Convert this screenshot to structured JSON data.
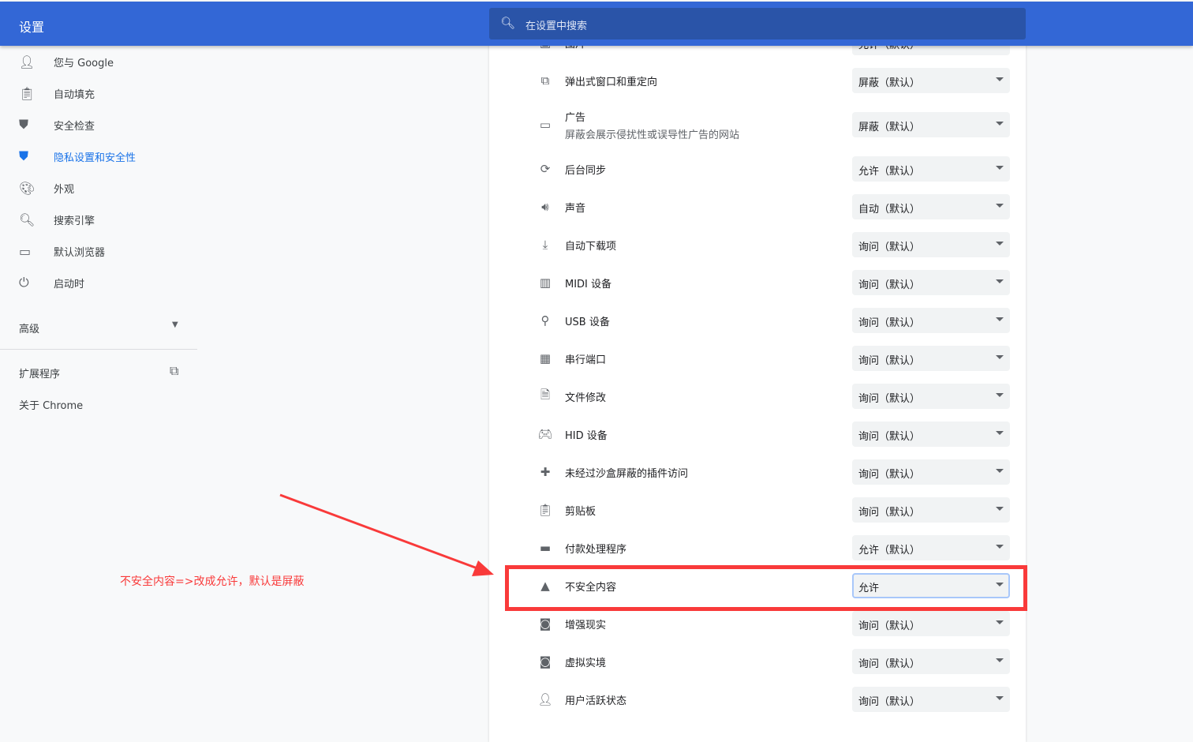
{
  "header": {
    "title": "设置",
    "search_placeholder": "在设置中搜索",
    "search_icon": "search-icon"
  },
  "sidebar": {
    "items": [
      {
        "label": "您与 Google",
        "icon": "person-icon"
      },
      {
        "label": "自动填充",
        "icon": "clipboard-icon"
      },
      {
        "label": "安全检查",
        "icon": "shield-check-icon"
      },
      {
        "label": "隐私设置和安全性",
        "icon": "shield-icon",
        "active": true
      },
      {
        "label": "外观",
        "icon": "palette-icon"
      },
      {
        "label": "搜索引擎",
        "icon": "search-icon"
      },
      {
        "label": "默认浏览器",
        "icon": "browser-icon"
      },
      {
        "label": "启动时",
        "icon": "power-icon"
      }
    ],
    "advanced": "高级",
    "extensions": "扩展程序",
    "about": "关于 Chrome"
  },
  "settings": [
    {
      "label": "图片",
      "value": "允许（默认）",
      "icon": "image-icon"
    },
    {
      "label": "弹出式窗口和重定向",
      "value": "屏蔽（默认）",
      "icon": "open-external-icon"
    },
    {
      "label": "广告",
      "sub": "屏蔽会展示侵扰性或误导性广告的网站",
      "value": "屏蔽（默认）",
      "icon": "ads-window-icon"
    },
    {
      "label": "后台同步",
      "value": "允许（默认）",
      "icon": "sync-icon"
    },
    {
      "label": "声音",
      "value": "自动（默认）",
      "icon": "volume-icon"
    },
    {
      "label": "自动下载项",
      "value": "询问（默认）",
      "icon": "download-icon"
    },
    {
      "label": "MIDI 设备",
      "value": "询问（默认）",
      "icon": "piano-icon"
    },
    {
      "label": "USB 设备",
      "value": "询问（默认）",
      "icon": "usb-icon"
    },
    {
      "label": "串行端口",
      "value": "询问（默认）",
      "icon": "serial-port-icon"
    },
    {
      "label": "文件修改",
      "value": "询问（默认）",
      "icon": "file-edit-icon"
    },
    {
      "label": "HID 设备",
      "value": "询问（默认）",
      "icon": "gamepad-icon"
    },
    {
      "label": "未经过沙盒屏蔽的插件访问",
      "value": "询问（默认）",
      "icon": "puzzle-icon"
    },
    {
      "label": "剪贴板",
      "value": "询问（默认）",
      "icon": "clipboard-icon"
    },
    {
      "label": "付款处理程序",
      "value": "允许（默认）",
      "icon": "credit-card-icon"
    },
    {
      "label": "不安全内容",
      "value": "允许",
      "icon": "warning-icon",
      "focused": true
    },
    {
      "label": "增强现实",
      "value": "询问（默认）",
      "icon": "vr-headset-icon"
    },
    {
      "label": "虚拟实境",
      "value": "询问（默认）",
      "icon": "vr-headset-icon"
    },
    {
      "label": "用户活跃状态",
      "value": "询问（默认）",
      "icon": "person-icon"
    }
  ],
  "annotation": {
    "text": "不安全内容=>改成允许，默认是屏蔽",
    "color": "#f93a3a"
  },
  "colors": {
    "header": "#3367d6",
    "accent": "#1a73e8"
  }
}
